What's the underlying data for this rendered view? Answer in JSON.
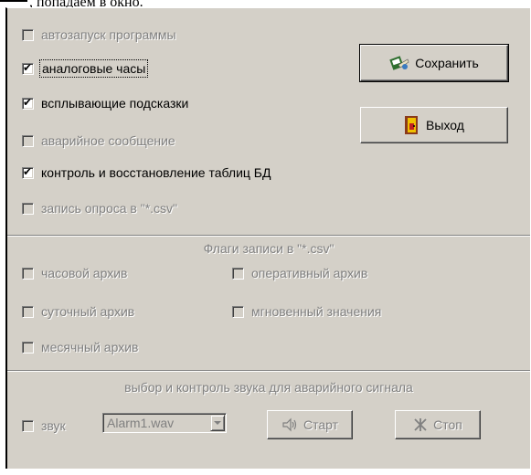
{
  "top_caption": ", попадаем в окно.",
  "options": [
    {
      "label": "автозапуск программы",
      "checked": false,
      "enabled": false
    },
    {
      "label": "аналоговые часы",
      "checked": true,
      "enabled": true
    },
    {
      "label": "всплывающие подсказки",
      "checked": true,
      "enabled": true
    },
    {
      "label": "аварийное сообщение",
      "checked": false,
      "enabled": false
    },
    {
      "label": "контроль и восстановление таблиц БД",
      "checked": true,
      "enabled": true
    },
    {
      "label": "запись опроса  в \"*.csv\"",
      "checked": false,
      "enabled": false
    }
  ],
  "buttons": {
    "save": "Сохранить",
    "exit": "Выход"
  },
  "csv_flags": {
    "title": "Флаги записи в \"*.csv\"",
    "items": [
      {
        "label": "часовой архив",
        "checked": false
      },
      {
        "label": "оперативный архив",
        "checked": false
      },
      {
        "label": "суточный архив",
        "checked": false
      },
      {
        "label": "мгновенный значения",
        "checked": false
      },
      {
        "label": "месячный архив",
        "checked": false
      }
    ]
  },
  "sound": {
    "title": "выбор и контроль звука для аварийного  сигнала",
    "checkbox_label": "звук",
    "file": "Alarm1.wav",
    "start": "Старт",
    "stop": "Стоп"
  },
  "colors": {
    "face": "#d4d0c8",
    "shadow": "#808080",
    "highlight": "#ffffff"
  }
}
